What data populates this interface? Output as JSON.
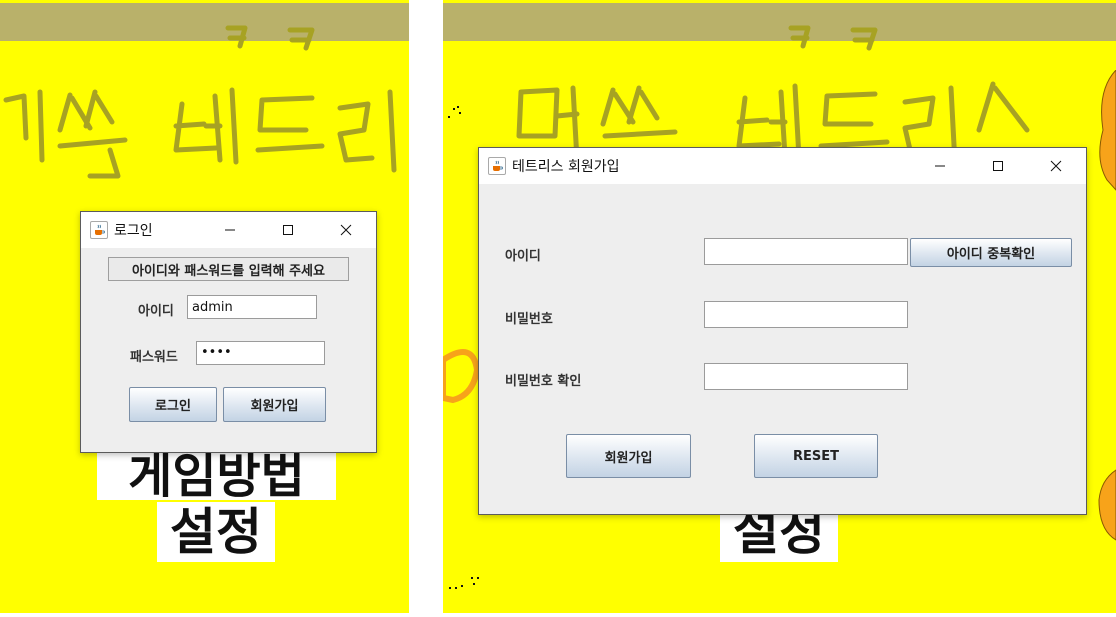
{
  "left_window": {
    "game_title_text": "머쓱테트리스",
    "game_subtitle_text": "ㅋㅋ",
    "menu_partial": "게임방법",
    "menu_settings": "설정",
    "login_dialog": {
      "title": "로그인",
      "prompt": "아이디와 패스워드를 입력해 주세요",
      "id_label": "아이디",
      "id_value": "admin",
      "password_label": "패스워드",
      "password_value": "••••",
      "login_button": "로그인",
      "signup_button": "회원가입"
    }
  },
  "right_window": {
    "game_title_text": "머쓱테트리스",
    "game_subtitle_text": "ㅋㅋ",
    "menu_settings": "설정",
    "signup_dialog": {
      "title": "테트리스 회원가입",
      "id_label": "아이디",
      "id_value": "",
      "check_duplicate_button": "아이디 중복확인",
      "password_label": "비밀번호",
      "password_value": "",
      "password_confirm_label": "비밀번호 확인",
      "password_confirm_value": "",
      "signup_button": "회원가입",
      "reset_button": "RESET"
    }
  },
  "colors": {
    "game_background": "#ffff00",
    "top_strip": "#b9b16a",
    "dialog_background": "#eeeeee",
    "handwriting": "#a7a223",
    "orange_character": "#f7a31a"
  },
  "icons": {
    "java_app_icon": "java-coffee-cup-icon",
    "minimize": "minimize-icon",
    "maximize": "maximize-icon",
    "close": "close-icon"
  }
}
